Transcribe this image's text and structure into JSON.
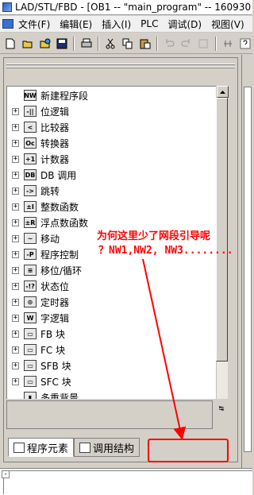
{
  "titlebar": {
    "title": "LAD/STL/FBD  - [OB1 -- \"main_program\" -- 160930"
  },
  "menubar": {
    "items": [
      "文件(F)",
      "编辑(E)",
      "插入(I)",
      "PLC",
      "调试(D)",
      "视图(V)"
    ]
  },
  "toolbar": {
    "icons": [
      "new-icon",
      "open-icon",
      "open-online-icon",
      "save-icon",
      "print-icon",
      "cut-icon",
      "copy-icon",
      "paste-icon",
      "undo-icon",
      "redo-icon",
      "blank-icon",
      "network-icon",
      "help-icon"
    ]
  },
  "tree": {
    "items": [
      {
        "label": "新建程序段",
        "icon_text": "NW",
        "expandable": false
      },
      {
        "label": "位逻辑",
        "icon_text": "-||",
        "expandable": true
      },
      {
        "label": "比较器",
        "icon_text": "<",
        "expandable": true
      },
      {
        "label": "转换器",
        "icon_text": "Oc",
        "expandable": true
      },
      {
        "label": "计数器",
        "icon_text": "+1",
        "expandable": true
      },
      {
        "label": "DB 调用",
        "icon_text": "DB",
        "expandable": true
      },
      {
        "label": "跳转",
        "icon_text": "->",
        "expandable": true
      },
      {
        "label": "整数函数",
        "icon_text": "±I",
        "expandable": true
      },
      {
        "label": "浮点数函数",
        "icon_text": "±R",
        "expandable": true
      },
      {
        "label": "移动",
        "icon_text": "~",
        "expandable": true
      },
      {
        "label": "程序控制",
        "icon_text": "-P",
        "expandable": true
      },
      {
        "label": "移位/循环",
        "icon_text": "≡",
        "expandable": true
      },
      {
        "label": "状态位",
        "icon_text": "-!?",
        "expandable": true
      },
      {
        "label": "定时器",
        "icon_text": "⊙",
        "expandable": true
      },
      {
        "label": "字逻辑",
        "icon_text": "W",
        "expandable": true
      },
      {
        "label": "FB 块",
        "icon_text": "▭",
        "expandable": true
      },
      {
        "label": "FC 块",
        "icon_text": "▭",
        "expandable": true
      },
      {
        "label": "SFB 块",
        "icon_text": "▭",
        "expandable": true
      },
      {
        "label": "SFC 块",
        "icon_text": "▭",
        "expandable": true
      },
      {
        "label": "多重背景",
        "icon_text": "▮",
        "expandable": false
      }
    ]
  },
  "tabs": [
    {
      "label": "程序元素",
      "active": true
    },
    {
      "label": "调用结构",
      "active": false
    }
  ],
  "annotation": {
    "line1": "为何这里少了网段引导呢",
    "line2": "？NW1,NW2, NW3........",
    "color": "#ff0000"
  }
}
